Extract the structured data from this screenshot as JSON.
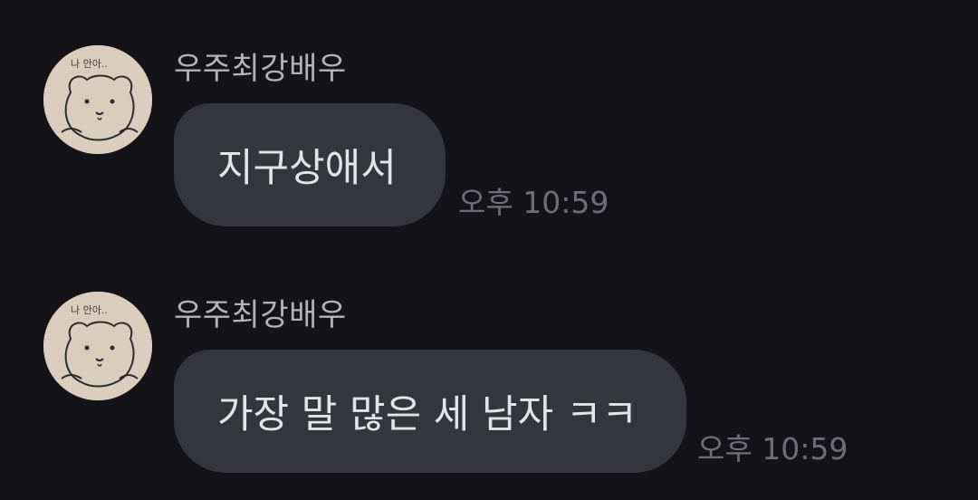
{
  "messages": [
    {
      "sender": "우주최강배우",
      "text": "지구상애서",
      "time": "오후 10:59"
    },
    {
      "sender": "우주최강배우",
      "text": "가장 말 많은 세 남자 ㅋㅋ",
      "time": "오후 10:59"
    }
  ],
  "avatar": {
    "icon": "bear-drawing-icon",
    "caption": "나 안아..",
    "background": "#d9cbbc"
  },
  "colors": {
    "background": "#141418",
    "bubble": "#35363c",
    "message_text": "#e4e4e6",
    "sender_text": "#b4b4b8",
    "time_text": "#6e6e74"
  }
}
